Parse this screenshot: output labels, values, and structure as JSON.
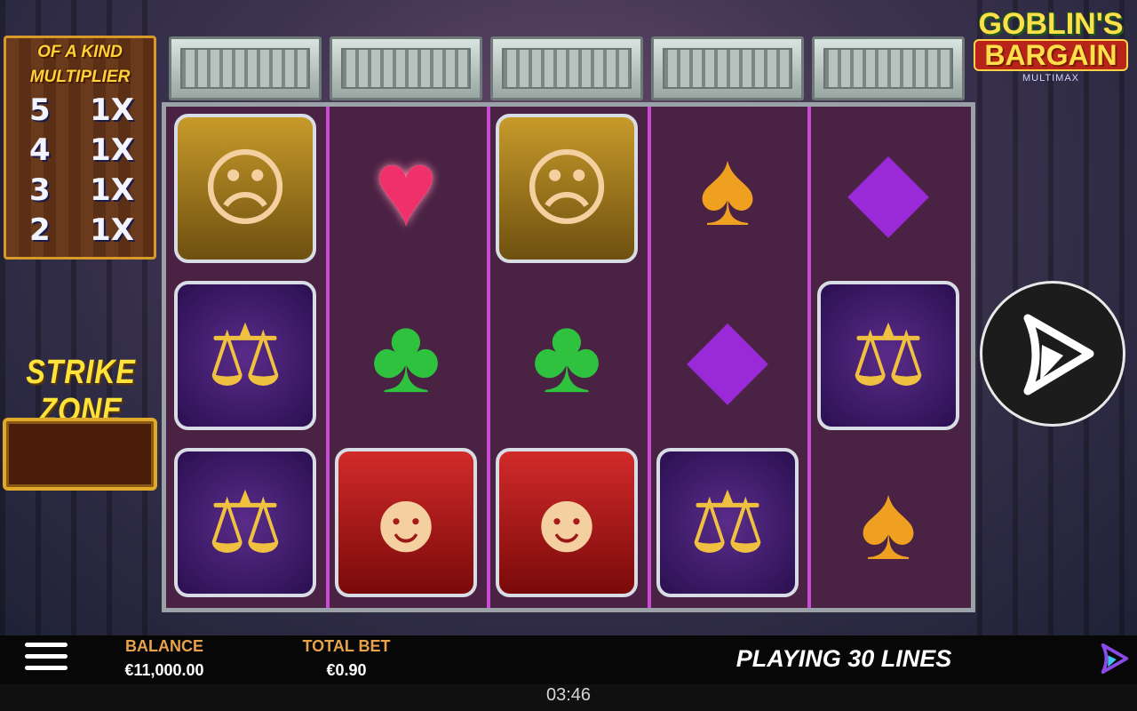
{
  "multiplier": {
    "title_line1": "OF A KIND",
    "title_line2": "MULTIPLIER",
    "rows": [
      {
        "kind": "5",
        "mult": "1X"
      },
      {
        "kind": "4",
        "mult": "1X"
      },
      {
        "kind": "3",
        "mult": "1X"
      },
      {
        "kind": "2",
        "mult": "1X"
      }
    ]
  },
  "strike_zone": {
    "title": "STRIKE ZONE"
  },
  "logo": {
    "line1": "GOBLIN'S",
    "line2": "BARGAIN",
    "line3": "MULTIMAX"
  },
  "reels": [
    [
      "banker",
      "scales",
      "scales"
    ],
    [
      "heart",
      "club",
      "witch"
    ],
    [
      "banker",
      "club",
      "witch"
    ],
    [
      "spade",
      "diamond",
      "scales"
    ],
    [
      "diamond",
      "scales",
      "spade"
    ]
  ],
  "footer": {
    "balance_label": "BALANCE",
    "balance_value": "€11,000.00",
    "bet_label": "TOTAL BET",
    "bet_value": "€0.90",
    "lines_text": "PLAYING 30 LINES",
    "clock": "03:46"
  },
  "icons": [
    "menu-icon",
    "spin-icon",
    "brand-icon"
  ],
  "colors": {
    "accent": "#e8a24a",
    "reel_divider": "#c84ad2"
  }
}
